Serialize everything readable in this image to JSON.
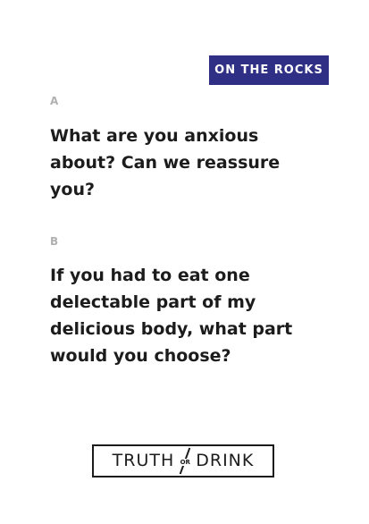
{
  "card": {
    "category_badge": "ON THE ROCKS",
    "question_a": {
      "letter": "A",
      "text": "What are you anxious about? Can we reassure you?"
    },
    "question_b": {
      "letter": "B",
      "text": "If you had to eat one delectable part of my delicious body, what part would you choose?"
    },
    "logo": {
      "word_left": "TRUTH",
      "word_middle": "OR",
      "word_right": "DRINK"
    }
  },
  "colors": {
    "badge_background": "#2f2f86",
    "badge_text": "#ffffff",
    "question_text": "#1c1c1c",
    "letter_text": "#b0b0b0",
    "background": "#ffffff"
  }
}
